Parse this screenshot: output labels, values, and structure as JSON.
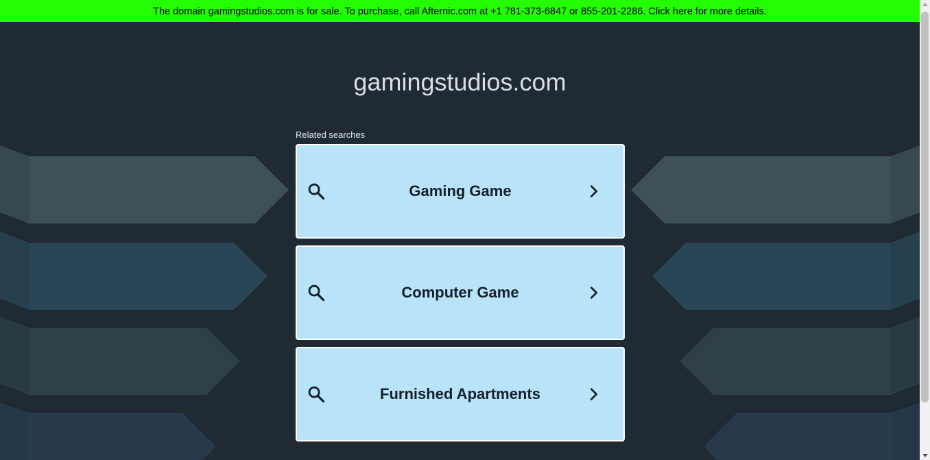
{
  "banner": {
    "text": "The domain gamingstudios.com is for sale. To purchase, call Afternic.com at +1 781-373-6847 or 855-201-2286. Click here for more details."
  },
  "site": {
    "domain": "gamingstudios.com"
  },
  "related": {
    "heading": "Related searches",
    "items": [
      {
        "label": "Gaming Game",
        "icon": "search-icon",
        "arrow": "chevron-right-icon"
      },
      {
        "label": "Computer Game",
        "icon": "search-icon",
        "arrow": "chevron-right-icon"
      },
      {
        "label": "Furnished Apartments",
        "icon": "search-icon",
        "arrow": "chevron-right-icon"
      }
    ]
  },
  "colors": {
    "banner_bg": "#24fc03",
    "page_bg": "#1f2a33",
    "result_bg": "#b8e3f8",
    "result_text": "#14202a"
  }
}
